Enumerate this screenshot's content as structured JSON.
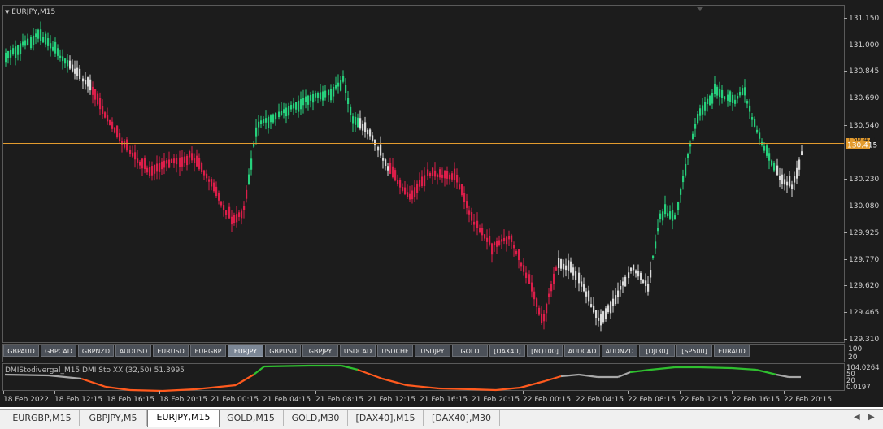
{
  "window": {
    "title": "EURJPY,M15",
    "collapse_glyph": "▼"
  },
  "colors": {
    "background": "#1c1c1c",
    "bull": "#26d07c",
    "bear": "#dc1e4a",
    "neutral": "#d9d9d9",
    "current_price_line": "#e39b2e",
    "indicator_green": "#2fbf2f",
    "indicator_orange": "#ff5a1e",
    "indicator_gray": "#a8a8a8"
  },
  "price_axis": {
    "labels": [
      "131.150",
      "131.000",
      "130.845",
      "130.690",
      "130.540",
      "130.230",
      "130.080",
      "129.925",
      "129.770",
      "129.620",
      "129.465",
      "129.310"
    ],
    "current_price": "130.415",
    "current_price_box_prev": "130.426"
  },
  "symbol_buttons": [
    {
      "label": "GBPAUD",
      "active": false
    },
    {
      "label": "GBPCAD",
      "active": false
    },
    {
      "label": "GBPNZD",
      "active": false
    },
    {
      "label": "AUDUSD",
      "active": false
    },
    {
      "label": "EURUSD",
      "active": false
    },
    {
      "label": "EURGBP",
      "active": false
    },
    {
      "label": "EURJPY",
      "active": true
    },
    {
      "label": "GBPUSD",
      "active": false
    },
    {
      "label": "GBPJPY",
      "active": false
    },
    {
      "label": "USDCAD",
      "active": false
    },
    {
      "label": "USDCHF",
      "active": false
    },
    {
      "label": "USDJPY",
      "active": false
    },
    {
      "label": "GOLD",
      "active": false
    },
    {
      "label": "[DAX40]",
      "active": false
    },
    {
      "label": "[NQ100]",
      "active": false
    },
    {
      "label": "AUDCAD",
      "active": false
    },
    {
      "label": "AUDNZD",
      "active": false
    },
    {
      "label": "[DJI30]",
      "active": false
    },
    {
      "label": "[SP500]",
      "active": false
    },
    {
      "label": "EURAUD",
      "active": false
    }
  ],
  "indicator": {
    "label": "DMIStodivergal_M15 DMI Sto XX (32,50) 51.3995",
    "axis_labels": [
      "104.0264",
      "50",
      "20",
      "0.0197"
    ],
    "top_labels": [
      "100",
      "20"
    ]
  },
  "time_axis": {
    "labels": [
      "18 Feb 2022",
      "18 Feb 12:15",
      "18 Feb 16:15",
      "18 Feb 20:15",
      "21 Feb 00:15",
      "21 Feb 04:15",
      "21 Feb 08:15",
      "21 Feb 12:15",
      "21 Feb 16:15",
      "21 Feb 20:15",
      "22 Feb 00:15",
      "22 Feb 04:15",
      "22 Feb 08:15",
      "22 Feb 12:15",
      "22 Feb 16:15",
      "22 Feb 20:15"
    ]
  },
  "tabs": [
    {
      "label": "EURGBP,M15",
      "active": false
    },
    {
      "label": "GBPJPY,M5",
      "active": false
    },
    {
      "label": "EURJPY,M15",
      "active": true
    },
    {
      "label": "GOLD,M15",
      "active": false
    },
    {
      "label": "GOLD,M30",
      "active": false
    },
    {
      "label": "[DAX40],M15",
      "active": false
    },
    {
      "label": "[DAX40],M30",
      "active": false
    }
  ],
  "tab_nav": {
    "prev_icon": "◀",
    "next_icon": "▶"
  },
  "chart_data": {
    "type": "candlestick",
    "symbol": "EURJPY",
    "timeframe": "M15",
    "current_price": 130.415,
    "ylim": [
      129.31,
      131.15
    ],
    "x": [
      "18 Feb 2022",
      "18 Feb 12:15",
      "18 Feb 16:15",
      "18 Feb 20:15",
      "21 Feb 00:15",
      "21 Feb 04:15",
      "21 Feb 08:15",
      "21 Feb 12:15",
      "21 Feb 16:15",
      "21 Feb 20:15",
      "22 Feb 00:15",
      "22 Feb 04:15",
      "22 Feb 08:15",
      "22 Feb 12:15",
      "22 Feb 16:15",
      "22 Feb 20:15"
    ],
    "close": [
      130.95,
      130.62,
      130.28,
      130.33,
      130.48,
      130.74,
      130.5,
      130.25,
      129.95,
      129.72,
      129.66,
      129.68,
      130.15,
      130.68,
      130.3,
      130.42
    ],
    "indicator_range": [
      0.0197,
      104.0264
    ]
  }
}
